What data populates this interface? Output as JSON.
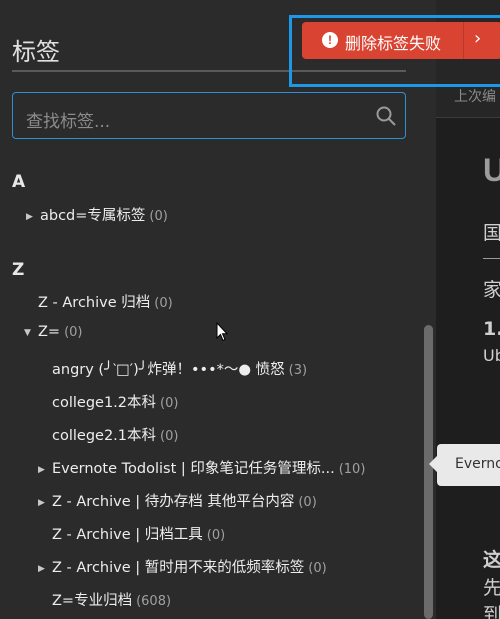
{
  "sidebar": {
    "title": "标签",
    "search": {
      "placeholder": "查找标签..."
    },
    "sections": [
      {
        "letter": "A",
        "items": [
          {
            "caret": "▶",
            "label": "abcd=专属标签",
            "count": "(0)"
          }
        ]
      },
      {
        "letter": "Z",
        "items": [
          {
            "caret": "",
            "label": "Z - Archive 归档",
            "count": "(0)"
          },
          {
            "caret": "▼",
            "label": "Z=",
            "count": "(0)"
          },
          {
            "caret": "",
            "label": "angry (╯‵□′)╯炸弹！•••*～● 愤怒",
            "count": "(3)"
          },
          {
            "caret": "",
            "label": "college1.2本科",
            "count": "(0)"
          },
          {
            "caret": "",
            "label": "college2.1本科",
            "count": "(0)"
          },
          {
            "caret": "▶",
            "label": "Evernote Todolist | 印象笔记任务管理标...",
            "count": "(10)"
          },
          {
            "caret": "▶",
            "label": "Z - Archive | 待办存档 其他平台内容",
            "count": "(0)"
          },
          {
            "caret": "",
            "label": "Z - Archive | 归档工具",
            "count": "(0)"
          },
          {
            "caret": "▶",
            "label": "Z - Archive | 暂时用不来的低频率标签",
            "count": "(0)"
          },
          {
            "caret": "",
            "label": "Z=专业归档",
            "count": "(608)"
          }
        ]
      }
    ]
  },
  "toast": {
    "text": "删除标签失败",
    "icon": "alert-icon",
    "close": "›"
  },
  "tooltip": {
    "text": "Everno"
  },
  "editor": {
    "last_edit": "上次编",
    "heading": "U",
    "lines": [
      "国",
      "家",
      "1.",
      "Ub",
      "这",
      "先",
      "到"
    ]
  },
  "colors": {
    "accent": "#2f8fd6",
    "toast": "#d94432",
    "highlight": "#1d97e6"
  }
}
